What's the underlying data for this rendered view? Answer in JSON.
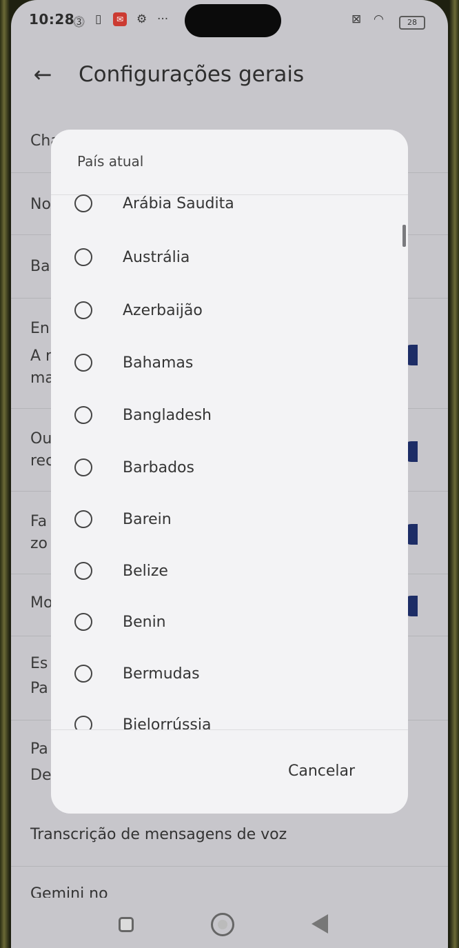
{
  "status_bar": {
    "time": "10:28",
    "battery": "28"
  },
  "header": {
    "title": "Configurações gerais"
  },
  "background_rows": [
    "Cha",
    "No",
    "Ba",
    "En",
    "A r",
    "ma",
    "Ou",
    "rec",
    "Fa",
    "zo",
    "Mo",
    "Es",
    "Pa",
    "Pa",
    "De"
  ],
  "background_bottom": {
    "voice_transcription": "Transcrição de mensagens de voz",
    "gemini": "Gemini no"
  },
  "dialog": {
    "title": "País atual",
    "options": [
      "Arábia Saudita",
      "Austrália",
      "Azerbaijão",
      "Bahamas",
      "Bangladesh",
      "Barbados",
      "Barein",
      "Belize",
      "Benin",
      "Bermudas",
      "Bielorrússia"
    ],
    "cancel_label": "Cancelar"
  },
  "colors": {
    "toggle_on": "#1d2d66",
    "dialog_bg": "#f3f3f5",
    "screen_bg": "#c7c6cb"
  }
}
